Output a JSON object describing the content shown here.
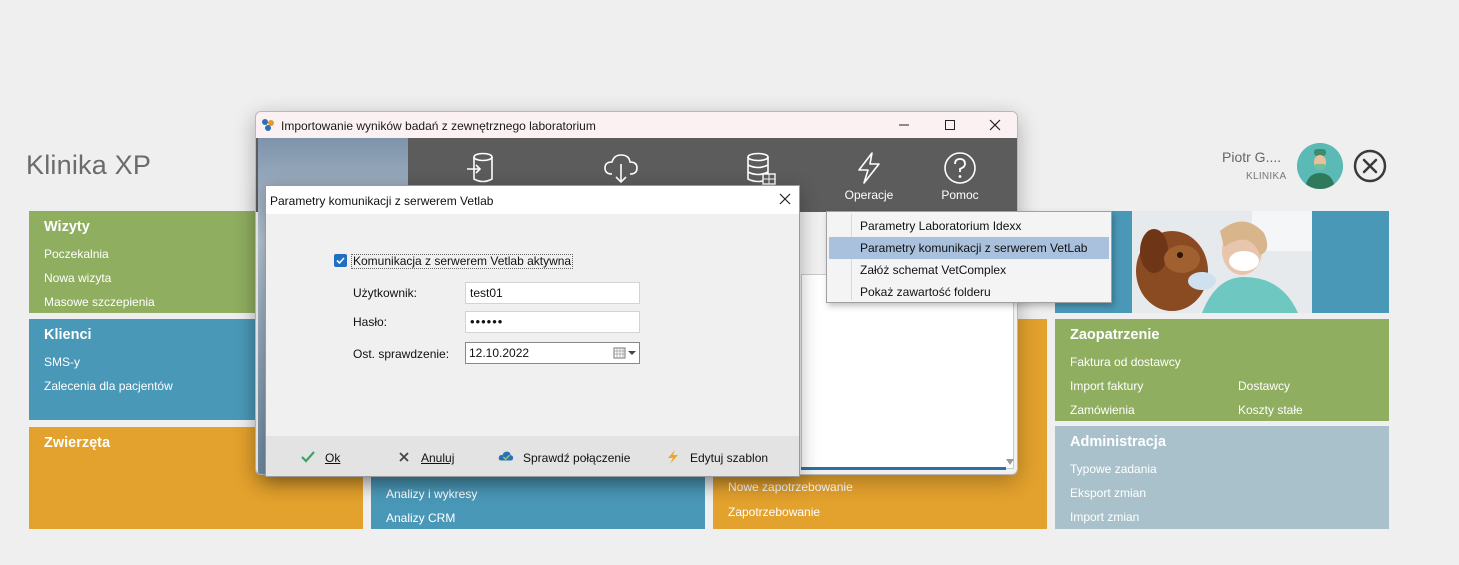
{
  "app": {
    "title": "Klinika XP"
  },
  "user": {
    "name": "Piotr G....",
    "role": "KLINIKA"
  },
  "tiles": {
    "wizyty": {
      "title": "Wizyty",
      "items": [
        "Poczekalnia",
        "Nowa wizyta",
        "Masowe szczepienia"
      ]
    },
    "klienci": {
      "title": "Klienci",
      "items": [
        "SMS-y",
        "Zalecenia dla pacjentów"
      ]
    },
    "zwierzeta": {
      "title": "Zwierzęta"
    },
    "analizy": {
      "items": [
        "Analizy i wykresy",
        "Analizy CRM"
      ]
    },
    "zapotrzebowanie": {
      "items": [
        "Nowe zapotrzebowanie",
        "Zapotrzebowanie"
      ]
    },
    "zaopatrzenie": {
      "title": "Zaopatrzenie",
      "items": [
        "Faktura od dostawcy",
        "Import faktury",
        "Dostawcy",
        "Zamówienia",
        "Koszty stałe"
      ]
    },
    "administracja": {
      "title": "Administracja",
      "items": [
        "Typowe zadania",
        "Eksport zmian",
        "Import zmian"
      ]
    }
  },
  "main_window": {
    "title": "Importowanie wyników badań z zewnętrznego laboratorium",
    "toolbar": [
      {
        "label": "",
        "icon": "database-import-icon"
      },
      {
        "label": "",
        "icon": "cloud-download-icon"
      },
      {
        "label": "",
        "icon": "database-table-icon"
      },
      {
        "label": "Operacje",
        "icon": "lightning-icon"
      },
      {
        "label": "Pomoc",
        "icon": "help-icon"
      }
    ]
  },
  "operations_menu": {
    "items": [
      {
        "label": "Parametry Laboratorium Idexx",
        "selected": false
      },
      {
        "label": "Parametry komunikacji z serwerem VetLab",
        "selected": true
      },
      {
        "label": "Załóż schemat VetComplex",
        "selected": false
      },
      {
        "label": "Pokaż zawartość folderu",
        "selected": false
      }
    ]
  },
  "dialog": {
    "title": "Parametry komunikacji z serwerem Vetlab",
    "active_checkbox": {
      "label": "Komunikacja z serwerem Vetlab aktywna",
      "checked": true
    },
    "fields": {
      "user": {
        "label": "Użytkownik:",
        "value": "test01"
      },
      "password": {
        "label": "Hasło:",
        "value": "••••••"
      },
      "last_check": {
        "label": "Ost. sprawdzenie:",
        "value": "12.10.2022"
      }
    },
    "buttons": {
      "ok": "Ok",
      "cancel": "Anuluj",
      "check": "Sprawdź połączenie",
      "template": "Edytuj szablon"
    }
  },
  "colors": {
    "green": "#8fae60",
    "blue": "#4a98b7",
    "orange": "#e3a12d",
    "grey": "#a9c1cb",
    "toolbar": "#5c5c5c",
    "selection": "#a9c1dd"
  }
}
